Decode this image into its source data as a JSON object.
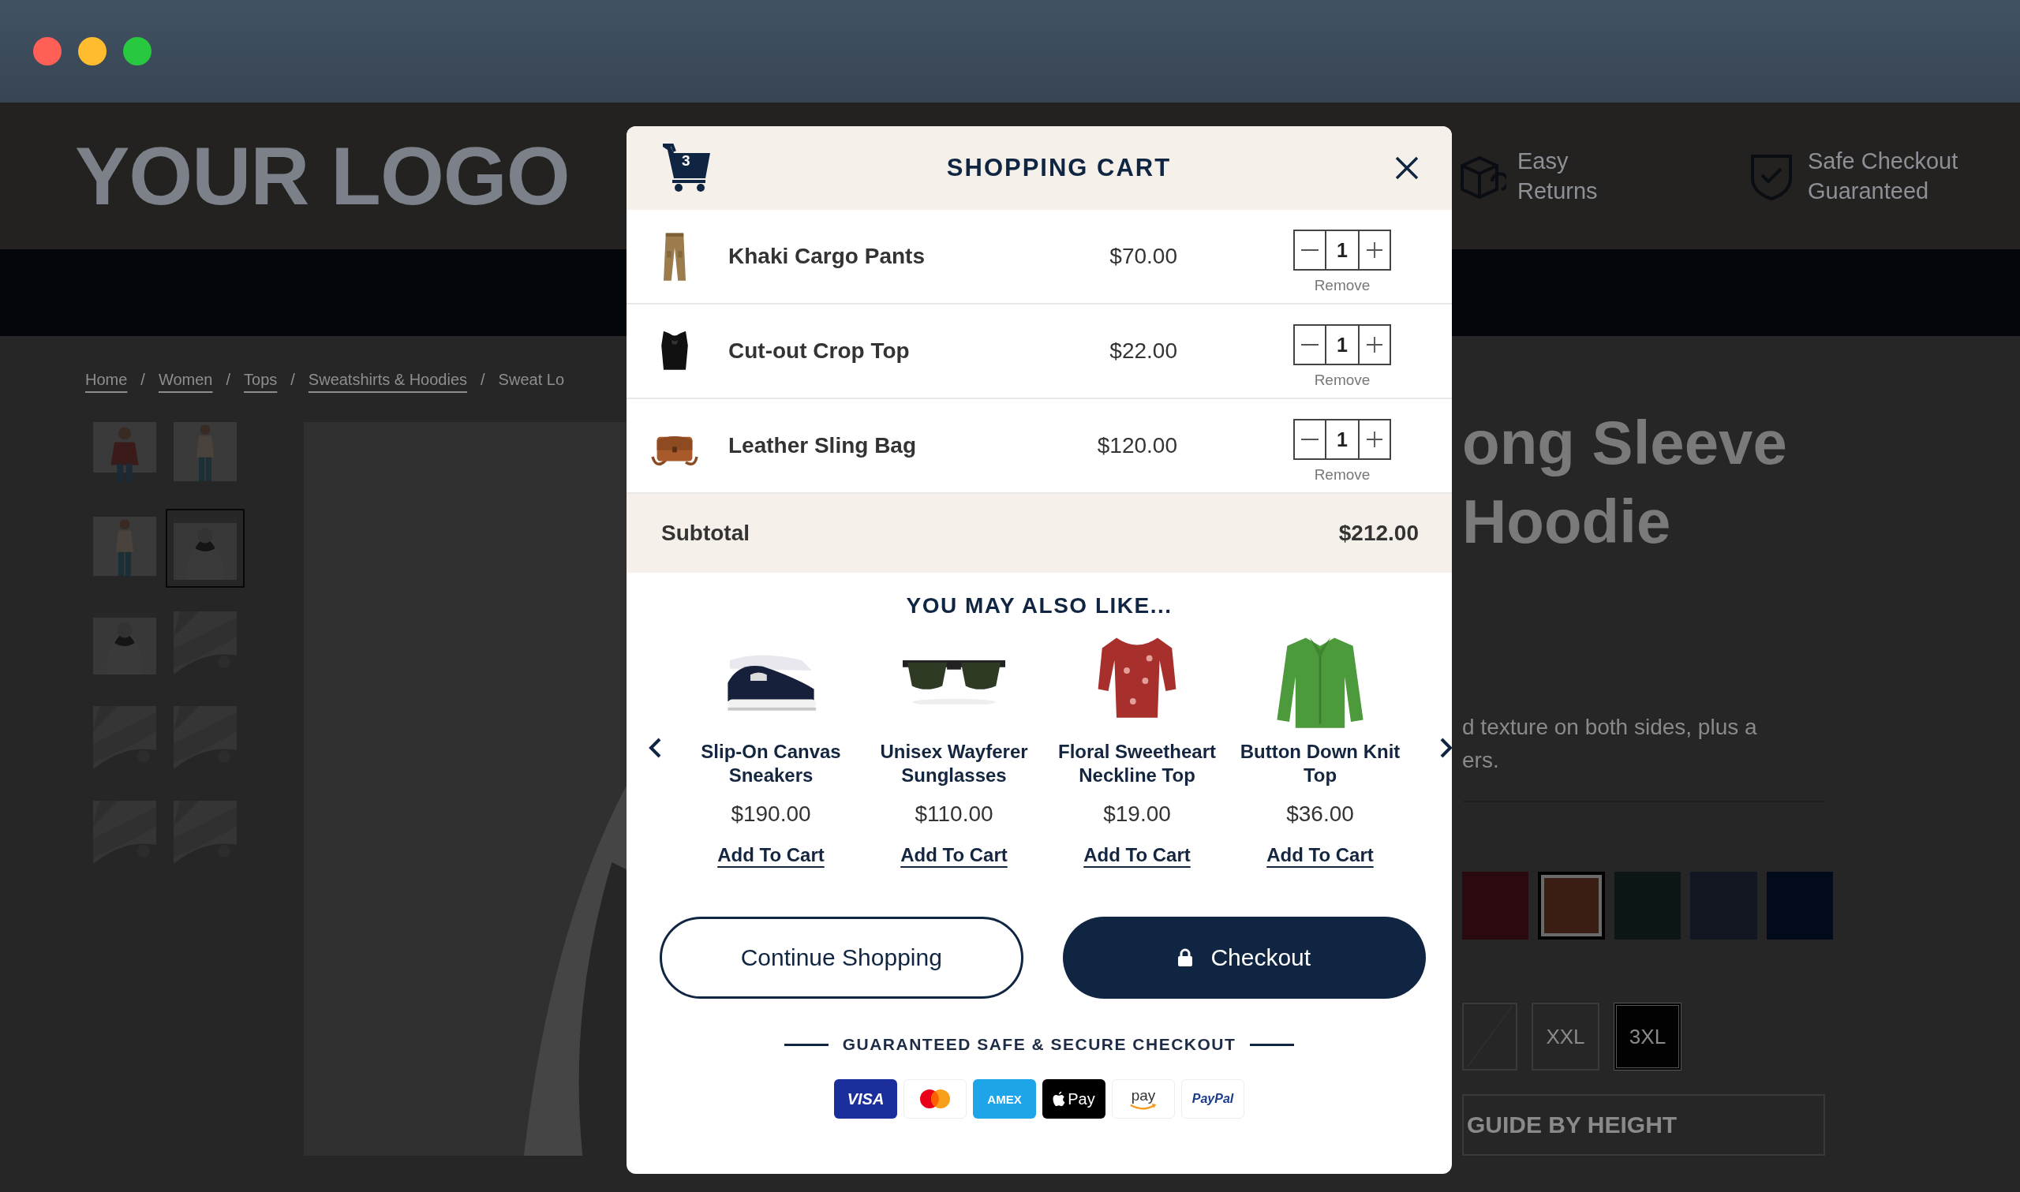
{
  "window": {
    "controls": [
      {
        "kind": "close"
      },
      {
        "kind": "minimize"
      },
      {
        "kind": "zoom"
      }
    ]
  },
  "header": {
    "logo": "YOUR LOGO",
    "perks": [
      {
        "kind": "returns",
        "lines": [
          "Easy",
          "Returns"
        ]
      },
      {
        "kind": "shield",
        "lines": [
          "Safe Checkout",
          "Guaranteed"
        ]
      }
    ]
  },
  "breadcrumb": {
    "separator": "/",
    "items": [
      {
        "label": "Home",
        "kind": "link"
      },
      {
        "label": "Women",
        "kind": "link"
      },
      {
        "label": "Tops",
        "kind": "link"
      },
      {
        "label": "Sweatshirts & Hoodies",
        "kind": "link"
      },
      {
        "label": "Sweat Lo",
        "kind": "current"
      }
    ]
  },
  "gallery": {
    "thumbnails": [
      {
        "kind": "picture",
        "selected": false
      },
      {
        "kind": "picture",
        "selected": false
      },
      {
        "kind": "picture",
        "selected": false
      },
      {
        "kind": "picture",
        "selected": true
      },
      {
        "kind": "picture",
        "selected": false
      },
      {
        "kind": "picture",
        "selected": false
      },
      {
        "kind": "picture",
        "selected": false
      },
      {
        "kind": "picture",
        "selected": false
      },
      {
        "kind": "picture",
        "selected": false
      },
      {
        "kind": "picture",
        "selected": false
      }
    ]
  },
  "product": {
    "title_lines": [
      "ong Sleeve",
      "Hoodie"
    ],
    "description_lines": [
      "d texture on both sides, plus a",
      "ers."
    ],
    "swatches": [
      {
        "color": "#2b0a0f",
        "selected": false
      },
      {
        "color": "#3a1d13",
        "selected": true
      },
      {
        "color": "#0c1614",
        "selected": false
      },
      {
        "color": "#121722",
        "selected": false
      },
      {
        "color": "#020b19",
        "selected": false
      }
    ],
    "sizes": [
      {
        "kind": "unavailable",
        "selected": false
      },
      {
        "kind": "size",
        "label": "XXL",
        "selected": false
      },
      {
        "kind": "size",
        "label": "3XL",
        "selected": true
      }
    ],
    "size_guide": "GUIDE BY HEIGHT"
  },
  "cart": {
    "title": "SHOPPING CART",
    "count": "3",
    "items": [
      {
        "name": "Khaki Cargo Pants",
        "price": "$70.00",
        "quantity": "1",
        "remove": "Remove"
      },
      {
        "name": "Cut-out Crop Top",
        "price": "$22.00",
        "quantity": "1",
        "remove": "Remove"
      },
      {
        "name": "Leather Sling Bag",
        "price": "$120.00",
        "quantity": "1",
        "remove": "Remove"
      }
    ],
    "subtotal": {
      "label": "Subtotal",
      "value": "$212.00"
    },
    "recommendations": {
      "title": "YOU MAY ALSO LIKE...",
      "products": [
        {
          "name": "Slip-On Canvas Sneakers",
          "price": "$190.00",
          "action": "Add To Cart"
        },
        {
          "name": "Unisex Wayferer Sunglasses",
          "price": "$110.00",
          "action": "Add To Cart"
        },
        {
          "name": "Floral Sweetheart Neckline Top",
          "price": "$19.00",
          "action": "Add To Cart"
        },
        {
          "name": "Button Down Knit Top",
          "price": "$36.00",
          "action": "Add To Cart"
        }
      ]
    },
    "buttons": [
      {
        "kind": "secondary",
        "label": "Continue Shopping"
      },
      {
        "kind": "primary",
        "label": "Checkout"
      }
    ],
    "secure_note": "GUARANTEED SAFE & SECURE CHECKOUT",
    "payments": [
      {
        "kind": "visa",
        "label": "VISA"
      },
      {
        "kind": "mastercard"
      },
      {
        "kind": "amex",
        "label": "AMEX"
      },
      {
        "kind": "applepay",
        "label": "Pay"
      },
      {
        "kind": "amazonpay",
        "label": "pay"
      },
      {
        "kind": "paypal",
        "label": "PayPal"
      }
    ]
  }
}
